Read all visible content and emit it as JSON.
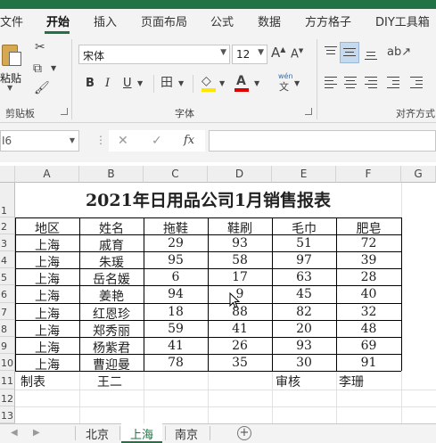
{
  "ribbon_tabs": [
    {
      "label": "文件",
      "active": false
    },
    {
      "label": "开始",
      "active": true
    },
    {
      "label": "插入",
      "active": false
    },
    {
      "label": "页面布局",
      "active": false
    },
    {
      "label": "公式",
      "active": false
    },
    {
      "label": "数据",
      "active": false
    },
    {
      "label": "方方格子",
      "active": false
    },
    {
      "label": "DIY工具箱",
      "active": false
    }
  ],
  "clipboard": {
    "paste_label": "粘贴",
    "group_label": "剪贴板"
  },
  "font": {
    "family": "宋体",
    "size": "12",
    "group_label": "字体",
    "bold": "B",
    "italic": "I",
    "underline": "U",
    "grow": "A",
    "shrink": "A",
    "phonetic_top": "wén",
    "phonetic_bottom": "文",
    "font_color_hex": "#e00000",
    "fill_color_hex": "#ffe600"
  },
  "alignment": {
    "group_label": "对齐方式"
  },
  "name_box": "I6",
  "formula": {
    "fx": "fx",
    "cancel": "✕",
    "enter": "✓",
    "value": ""
  },
  "columns": [
    "A",
    "B",
    "C",
    "D",
    "E",
    "F",
    "G"
  ],
  "rows": [
    "1",
    "2",
    "3",
    "4",
    "5",
    "6",
    "7",
    "8",
    "9",
    "10",
    "11",
    "12",
    "13"
  ],
  "sheet": {
    "title": "2021年日用品公司1月销售报表",
    "headers": [
      "地区",
      "姓名",
      "拖鞋",
      "鞋刷",
      "毛巾",
      "肥皂"
    ],
    "data": [
      [
        "上海",
        "戚育",
        "29",
        "93",
        "51",
        "72"
      ],
      [
        "上海",
        "朱瑗",
        "95",
        "58",
        "97",
        "39"
      ],
      [
        "上海",
        "岳名媛",
        "6",
        "17",
        "63",
        "28"
      ],
      [
        "上海",
        "姜艳",
        "94",
        "9",
        "45",
        "40"
      ],
      [
        "上海",
        "红恩珍",
        "18",
        "88",
        "82",
        "32"
      ],
      [
        "上海",
        "郑秀丽",
        "59",
        "41",
        "20",
        "48"
      ],
      [
        "上海",
        "杨紫君",
        "41",
        "26",
        "93",
        "69"
      ],
      [
        "上海",
        "曹迎曼",
        "78",
        "35",
        "30",
        "91"
      ]
    ],
    "footer": {
      "label1": "制表",
      "name1": "王二",
      "label2": "审核",
      "name2": "李珊"
    }
  },
  "sheet_tabs": [
    {
      "label": "北京",
      "active": false
    },
    {
      "label": "上海",
      "active": true
    },
    {
      "label": "南京",
      "active": false
    }
  ],
  "add_sheet": "+"
}
